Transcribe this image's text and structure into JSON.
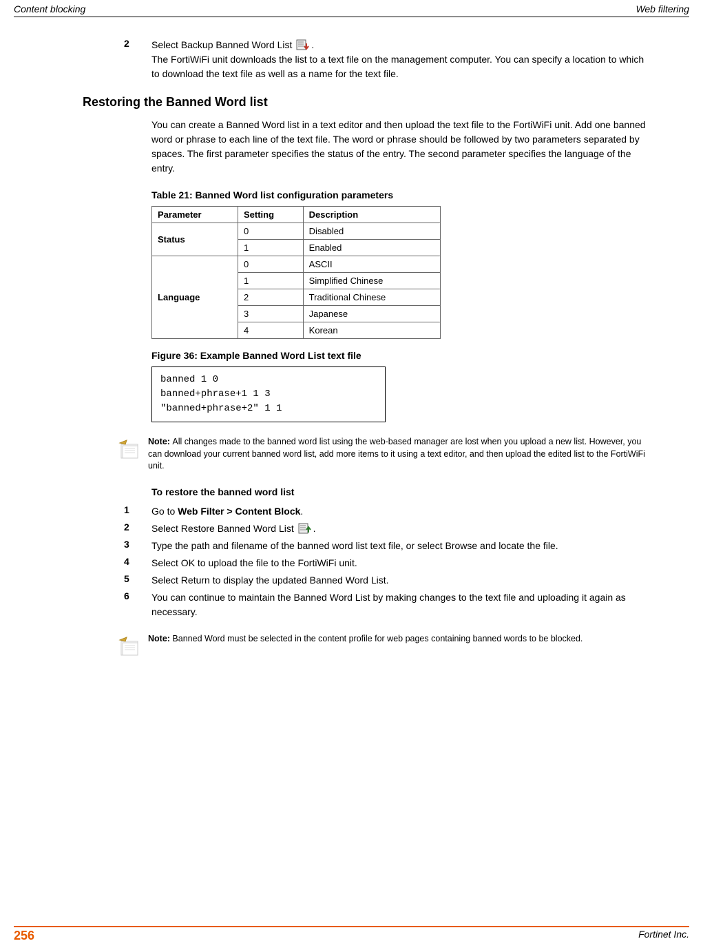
{
  "header": {
    "left": "Content blocking",
    "right": "Web filtering"
  },
  "step2": {
    "num": "2",
    "text_a": "Select Backup Banned Word List ",
    "text_b": ".",
    "cont": "The FortiWiFi unit downloads the list to a text file on the management computer. You can specify a location to which to download the text file as well as a name for the text file."
  },
  "h2": "Restoring the Banned Word list",
  "restore_intro": "You can create a Banned Word list in a text editor and then upload the text file to the FortiWiFi unit. Add one banned word or phrase to each line of the text file. The word or phrase should be followed by two parameters separated by spaces. The first parameter specifies the status of the entry. The second parameter specifies the language of the entry.",
  "table": {
    "caption": "Table 21: Banned Word list configuration parameters",
    "headers": [
      "Parameter",
      "Setting",
      "Description"
    ],
    "rows": [
      {
        "param": "Status",
        "setting": "0",
        "desc": "Disabled"
      },
      {
        "param": "",
        "setting": "1",
        "desc": "Enabled"
      },
      {
        "param": "Language",
        "setting": "0",
        "desc": "ASCII"
      },
      {
        "param": "",
        "setting": "1",
        "desc": "Simplified Chinese"
      },
      {
        "param": "",
        "setting": "2",
        "desc": "Traditional Chinese"
      },
      {
        "param": "",
        "setting": "3",
        "desc": "Japanese"
      },
      {
        "param": "",
        "setting": "4",
        "desc": "Korean"
      }
    ]
  },
  "figure_caption": "Figure 36: Example Banned Word List text file",
  "code": {
    "line1": "banned 1 0",
    "line2": "banned+phrase+1 1 3",
    "line3": "\"banned+phrase+2\" 1 1"
  },
  "note1": {
    "label": "Note: ",
    "text": "All changes made to the banned word list using the web-based manager are lost when you upload a new list. However, you can download your current banned word list, add more items to it using a text editor, and then upload the edited list to the FortiWiFi unit."
  },
  "subheading": "To restore the banned word list",
  "steps": {
    "s1": {
      "num": "1",
      "pre": "Go to ",
      "bold": "Web Filter > Content Block",
      "post": "."
    },
    "s2": {
      "num": "2",
      "text_a": "Select Restore Banned Word List ",
      "text_b": "."
    },
    "s3": {
      "num": "3",
      "text": "Type the path and filename of the banned word list text file, or select Browse and locate the file."
    },
    "s4": {
      "num": "4",
      "text": "Select OK to upload the file to the FortiWiFi unit."
    },
    "s5": {
      "num": "5",
      "text": "Select Return to display the updated Banned Word List."
    },
    "s6": {
      "num": "6",
      "text": "You can continue to maintain the Banned Word List by making changes to the text file and uploading it again as necessary."
    }
  },
  "note2": {
    "label": "Note: ",
    "text": "Banned Word must be selected in the content profile for web pages containing banned words to be blocked."
  },
  "footer": {
    "pagenum": "256",
    "right": "Fortinet Inc."
  }
}
